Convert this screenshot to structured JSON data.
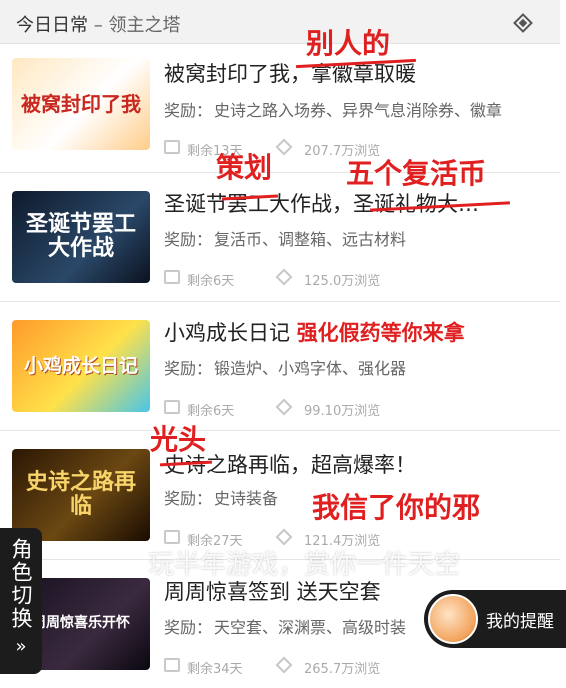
{
  "header": {
    "title": "今日日常",
    "subtitle": "领主之塔"
  },
  "reward_prefix": "奖励：",
  "items": [
    {
      "thumb_text": "被窝封印了我",
      "title": "被窝封印了我，拿徽章取暖",
      "rewards": "史诗之路入场券、异界气息消除券、徽章",
      "days_left": "剩余13天",
      "views": "207.7万浏览"
    },
    {
      "thumb_text": "圣诞节罢工大作战",
      "title": "圣诞节罢工大作战，圣诞礼物大…",
      "rewards": "复活币、调整箱、远古材料",
      "days_left": "剩余6天",
      "views": "125.0万浏览"
    },
    {
      "thumb_text": "小鸡成长日记",
      "title": "小鸡成长日记",
      "title_annot": "强化假药等你来拿",
      "rewards": "锻造炉、小鸡字体、强化器",
      "days_left": "剩余6天",
      "views": "99.10万浏览"
    },
    {
      "thumb_text": "史诗之路再临",
      "title": "史诗之路再临，超高爆率！",
      "rewards": "史诗装备",
      "days_left": "剩余27天",
      "views": "121.4万浏览"
    },
    {
      "thumb_text": "周周惊喜乐开怀",
      "title": "周周惊喜签到 送天空套",
      "rewards": "天空套、深渊票、高级时装",
      "days_left": "剩余34天",
      "views": "265.7万浏览"
    }
  ],
  "annotations": {
    "a1": "别人的",
    "a2": "策划",
    "a3": "五个复活币",
    "a4": "光头",
    "a5": "我信了你的邪"
  },
  "watermark": "玩半年游戏，赏你一件天空",
  "side_tab": {
    "label": "角色切换",
    "chevron": "»"
  },
  "reminder": {
    "label": "我的提醒"
  },
  "colors": {
    "accent_red": "#e02020",
    "header_bg": "#f2f2f2",
    "overlay_dark": "#1c1c1c"
  }
}
